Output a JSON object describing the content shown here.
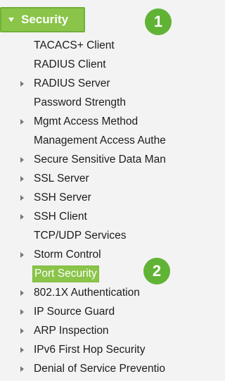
{
  "header": {
    "title": "Security",
    "expanded": true
  },
  "badges": [
    "1",
    "2"
  ],
  "menu": {
    "items": [
      {
        "label": "TACACS+ Client",
        "has_children": false
      },
      {
        "label": "RADIUS Client",
        "has_children": false
      },
      {
        "label": "RADIUS Server",
        "has_children": true
      },
      {
        "label": "Password Strength",
        "has_children": false
      },
      {
        "label": "Mgmt Access Method",
        "has_children": true
      },
      {
        "label": "Management Access Authe",
        "has_children": false
      },
      {
        "label": "Secure Sensitive Data Man",
        "has_children": true
      },
      {
        "label": "SSL Server",
        "has_children": true
      },
      {
        "label": "SSH Server",
        "has_children": true
      },
      {
        "label": "SSH Client",
        "has_children": true
      },
      {
        "label": "TCP/UDP Services",
        "has_children": false
      },
      {
        "label": "Storm Control",
        "has_children": true
      },
      {
        "label": "Port Security",
        "has_children": false,
        "highlighted": true
      },
      {
        "label": "802.1X Authentication",
        "has_children": true
      },
      {
        "label": "IP Source Guard",
        "has_children": true
      },
      {
        "label": "ARP Inspection",
        "has_children": true
      },
      {
        "label": "IPv6 First Hop Security",
        "has_children": true
      },
      {
        "label": "Denial of Service Preventio",
        "has_children": true
      }
    ]
  },
  "colors": {
    "highlight": "#8ac449",
    "badge": "#61b335",
    "background": "#f3f3f3",
    "text": "#1c1c1c"
  }
}
